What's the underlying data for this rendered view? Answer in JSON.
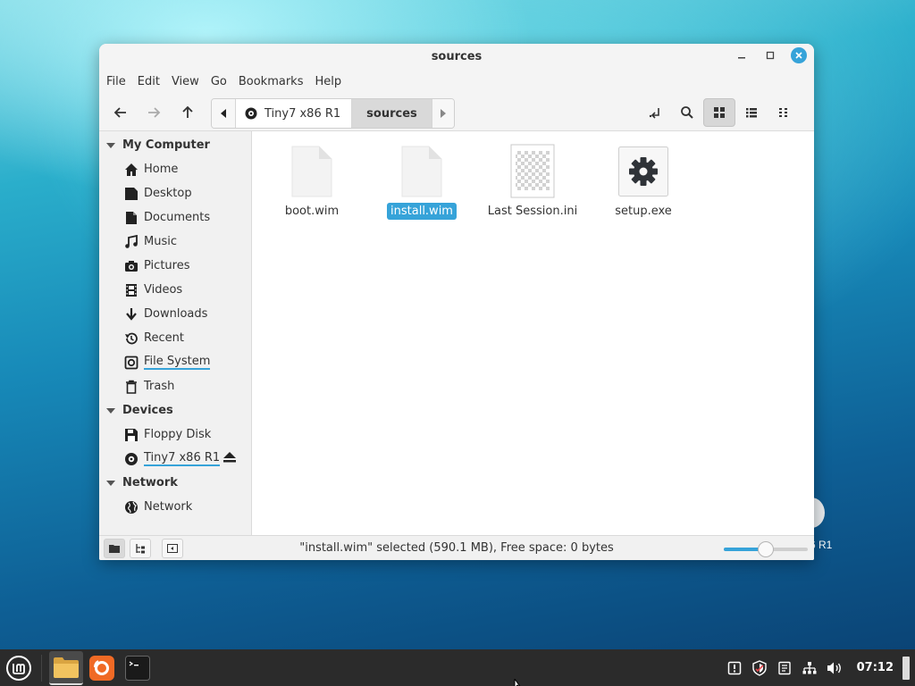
{
  "window": {
    "title": "sources",
    "controls": {
      "minimize": "minimize",
      "maximize": "maximize",
      "close": "close"
    }
  },
  "menubar": [
    "File",
    "Edit",
    "View",
    "Go",
    "Bookmarks",
    "Help"
  ],
  "path": {
    "crumbs": [
      {
        "label": "Tiny7 x86 R1",
        "icon": "disc-icon"
      },
      {
        "label": "sources",
        "active": true
      }
    ]
  },
  "sidebar": {
    "sections": [
      {
        "title": "My Computer",
        "items": [
          {
            "label": "Home",
            "icon": "home-icon"
          },
          {
            "label": "Desktop",
            "icon": "desktop-icon"
          },
          {
            "label": "Documents",
            "icon": "documents-icon"
          },
          {
            "label": "Music",
            "icon": "music-icon"
          },
          {
            "label": "Pictures",
            "icon": "pictures-icon"
          },
          {
            "label": "Videos",
            "icon": "videos-icon"
          },
          {
            "label": "Downloads",
            "icon": "downloads-icon"
          },
          {
            "label": "Recent",
            "icon": "recent-icon"
          },
          {
            "label": "File System",
            "icon": "filesystem-icon",
            "usage_bar": true
          },
          {
            "label": "Trash",
            "icon": "trash-icon"
          }
        ]
      },
      {
        "title": "Devices",
        "items": [
          {
            "label": "Floppy Disk",
            "icon": "floppy-icon"
          },
          {
            "label": "Tiny7 x86 R1",
            "icon": "disc-icon",
            "usage_bar": true,
            "ejectable": true
          }
        ]
      },
      {
        "title": "Network",
        "items": [
          {
            "label": "Network",
            "icon": "network-icon"
          }
        ]
      }
    ]
  },
  "files": [
    {
      "name": "boot.wim",
      "icon": "blank-file-icon",
      "selected": false
    },
    {
      "name": "install.wim",
      "icon": "blank-file-icon",
      "selected": true
    },
    {
      "name": "Last Session.ini",
      "icon": "image-file-icon",
      "selected": false
    },
    {
      "name": "setup.exe",
      "icon": "gear-icon",
      "selected": false
    }
  ],
  "statusbar": {
    "text": "\"install.wim\" selected (590.1 MB), Free space: 0 bytes",
    "zoom_level": 0.5
  },
  "desktop": {
    "icon_label": "6 R1"
  },
  "taskbar": {
    "apps": [
      "file-manager",
      "firefox",
      "terminal"
    ],
    "clock": "07:12"
  },
  "colors": {
    "accent": "#36a3d9",
    "taskbar": "#2b2b2b"
  }
}
